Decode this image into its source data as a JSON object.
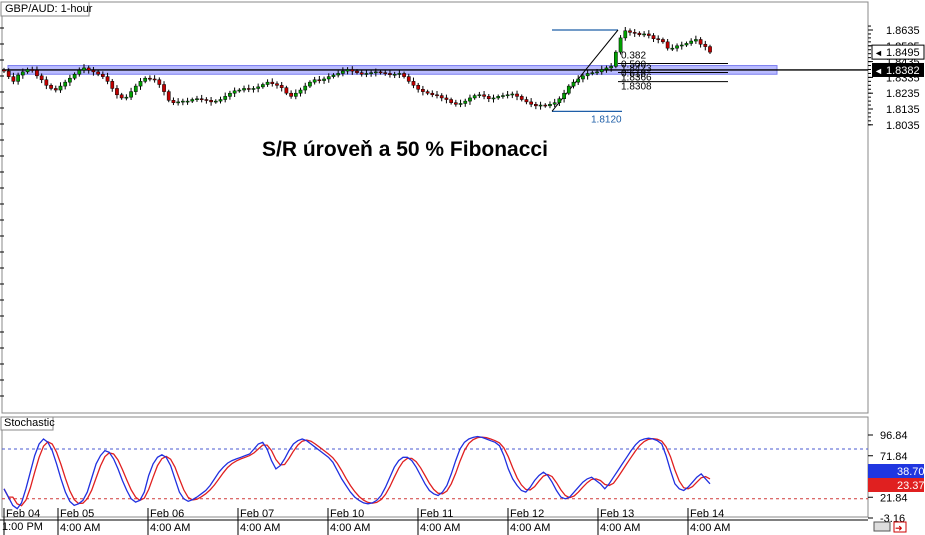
{
  "chart_data": {
    "type": "candlestick",
    "title": "GBP/AUD: 1-hour",
    "annotation": "S/R úroveň a 50 % Fibonacci",
    "price_ticks": [
      "1.8635",
      "1.8535",
      "1.8435",
      "1.8335",
      "1.8235",
      "1.8135",
      "1.8035"
    ],
    "current_price": "1.8495",
    "sr_level": "1.8382",
    "sr_level_value": 1.8382,
    "sr_zone": [
      1.8355,
      1.841
    ],
    "swing_high": 1.8635,
    "swing_low": 1.812,
    "swing_low_label": "1.8120",
    "fibonacci": [
      {
        "ratio": "0.382",
        "price": "1.8423",
        "value": 1.8423
      },
      {
        "ratio": "0.500",
        "price": "1.8366",
        "value": 1.8366
      },
      {
        "ratio": "0.618",
        "price": "1.8308",
        "value": 1.8308
      }
    ],
    "date_labels": [
      "1:00 PM",
      "Feb 04",
      "Feb 05",
      "Feb 06",
      "Feb 07",
      "Feb 10",
      "Feb 11",
      "Feb 12",
      "Feb 13",
      "Feb 14"
    ],
    "time_labels": [
      "4:00 AM",
      "4:00 AM",
      "4:00 AM",
      "4:00 AM",
      "4:00 AM",
      "4:00 AM",
      "4:00 AM",
      "4:00 AM"
    ],
    "price_path": [
      1.8375,
      1.834,
      1.831,
      1.835,
      1.837,
      1.8385,
      1.838,
      1.8345,
      1.832,
      1.8285,
      1.8265,
      1.8255,
      1.828,
      1.8305,
      1.833,
      1.8355,
      1.838,
      1.8395,
      1.838,
      1.837,
      1.8355,
      1.834,
      1.831,
      1.8265,
      1.8225,
      1.8205,
      1.821,
      1.8245,
      1.828,
      1.831,
      1.833,
      1.8325,
      1.832,
      1.829,
      1.8245,
      1.819,
      1.8175,
      1.818,
      1.8185,
      1.8185,
      1.8195,
      1.82,
      1.8195,
      1.819,
      1.818,
      1.8185,
      1.8195,
      1.8215,
      1.8235,
      1.825,
      1.8255,
      1.8265,
      1.826,
      1.8265,
      1.8275,
      1.829,
      1.8305,
      1.8295,
      1.8285,
      1.827,
      1.8235,
      1.8215,
      1.8235,
      1.8255,
      1.828,
      1.8305,
      1.832,
      1.8315,
      1.8325,
      1.834,
      1.835,
      1.836,
      1.8375,
      1.8385,
      1.8375,
      1.8365,
      1.8355,
      1.836,
      1.8365,
      1.837,
      1.8365,
      1.836,
      1.8352,
      1.8355,
      1.836,
      1.834,
      1.831,
      1.8285,
      1.826,
      1.8245,
      1.8235,
      1.8225,
      1.822,
      1.8205,
      1.8195,
      1.8175,
      1.8165,
      1.817,
      1.8185,
      1.8205,
      1.822,
      1.8225,
      1.8215,
      1.82,
      1.8205,
      1.8215,
      1.822,
      1.8225,
      1.823,
      1.8215,
      1.8195,
      1.818,
      1.8165,
      1.8155,
      1.816,
      1.8155,
      1.8165,
      1.8175,
      1.82,
      1.8235,
      1.828,
      1.8305,
      1.8325,
      1.8345,
      1.836,
      1.8365,
      1.837,
      1.8385,
      1.8395,
      1.8405,
      1.8495,
      1.8585,
      1.863,
      1.862,
      1.8615,
      1.8605,
      1.861,
      1.86,
      1.858,
      1.8575,
      1.856,
      1.852,
      1.852,
      1.8535,
      1.854,
      1.855,
      1.8565,
      1.8575,
      1.8545,
      1.853,
      1.8495
    ],
    "stochastic": {
      "label": "Stochastic",
      "ticks": [
        "96.84",
        "71.84",
        "46.84",
        "21.84",
        "-3.16"
      ],
      "k_value": "38.70",
      "d_value": "23.37",
      "overbought": 80,
      "oversold": 20,
      "k_series": [
        32,
        22,
        12,
        8,
        15,
        32,
        52,
        72,
        86,
        92,
        88,
        78,
        62,
        44,
        28,
        17,
        12,
        14,
        18,
        28,
        45,
        62,
        72,
        78,
        76,
        68,
        56,
        42,
        30,
        20,
        16,
        18,
        28,
        48,
        62,
        70,
        73,
        70,
        60,
        44,
        28,
        20,
        17,
        19,
        22,
        26,
        30,
        36,
        44,
        52,
        58,
        63,
        66,
        68,
        70,
        72,
        74,
        80,
        86,
        88,
        80,
        66,
        56,
        60,
        68,
        78,
        86,
        90,
        92,
        90,
        86,
        82,
        78,
        74,
        70,
        64,
        54,
        44,
        36,
        28,
        22,
        18,
        15,
        14,
        15,
        18,
        24,
        34,
        46,
        58,
        66,
        70,
        70,
        66,
        58,
        48,
        38,
        30,
        26,
        24,
        28,
        36,
        50,
        66,
        80,
        88,
        92,
        94,
        95,
        94,
        92,
        90,
        88,
        84,
        72,
        56,
        44,
        36,
        30,
        28,
        34,
        42,
        48,
        52,
        48,
        40,
        30,
        22,
        20,
        22,
        28,
        34,
        40,
        44,
        46,
        42,
        38,
        32,
        38,
        46,
        54,
        62,
        70,
        78,
        85,
        90,
        92,
        93,
        92,
        90,
        86,
        72,
        54,
        38,
        32,
        30,
        34,
        40,
        46,
        50,
        44,
        38
      ]
    }
  }
}
